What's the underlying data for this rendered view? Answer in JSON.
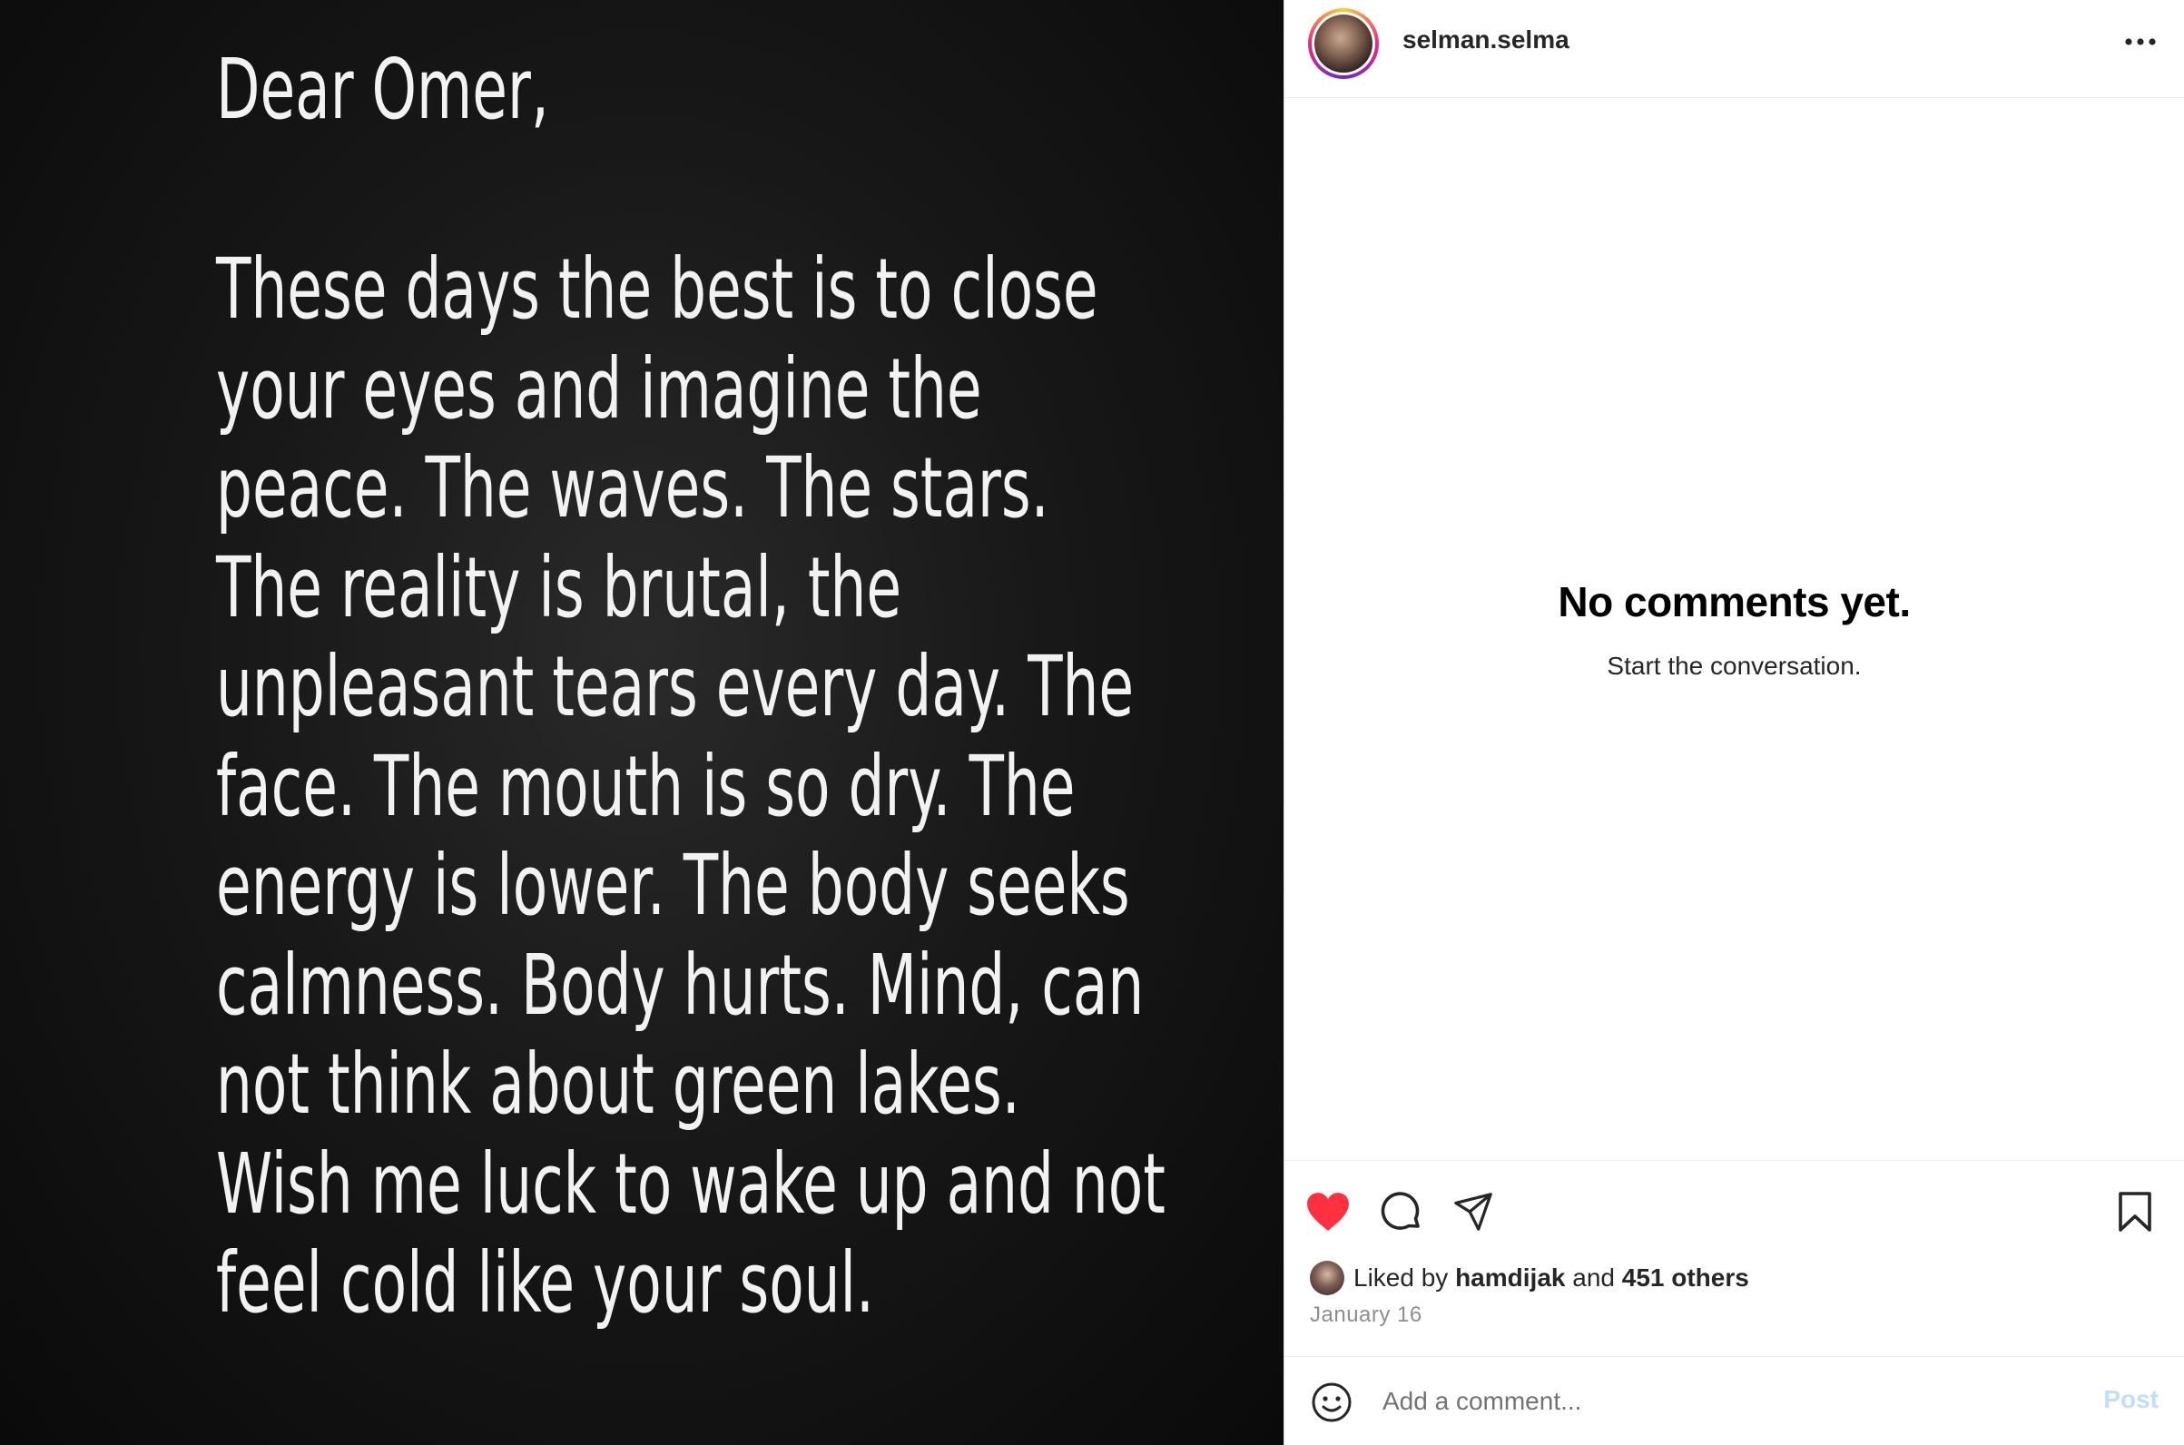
{
  "post_image": {
    "greeting": "Dear Omer,",
    "lines": [
      "These days the best is to close",
      "your eyes and imagine the",
      "peace. The waves. The stars.",
      "The reality is brutal, the",
      "unpleasant tears every day. The",
      "face. The mouth is so dry. The",
      "energy is lower. The body seeks",
      "calmness. Body hurts. Mind, can",
      "not think about green lakes.",
      "Wish me luck to wake up and not",
      "feel cold like your soul."
    ]
  },
  "header": {
    "username": "selman.selma",
    "avatar_icon": "profile-avatar",
    "more_icon": "more-horizontal-icon"
  },
  "comments": {
    "empty_title": "No comments yet.",
    "empty_subtitle": "Start the conversation."
  },
  "actions": {
    "like_icon": "heart-filled-icon",
    "comment_icon": "comment-bubble-icon",
    "share_icon": "paper-plane-icon",
    "save_icon": "bookmark-icon",
    "like_color": "#ff3040"
  },
  "likes": {
    "prefix": "Liked by",
    "user": "hamdijak",
    "joiner": "and",
    "others": "451 others"
  },
  "date": "January 16",
  "comment_bar": {
    "emoji_icon": "smiley-icon",
    "placeholder": "Add a comment...",
    "post_label": "Post",
    "post_color": "#c0dffd"
  }
}
